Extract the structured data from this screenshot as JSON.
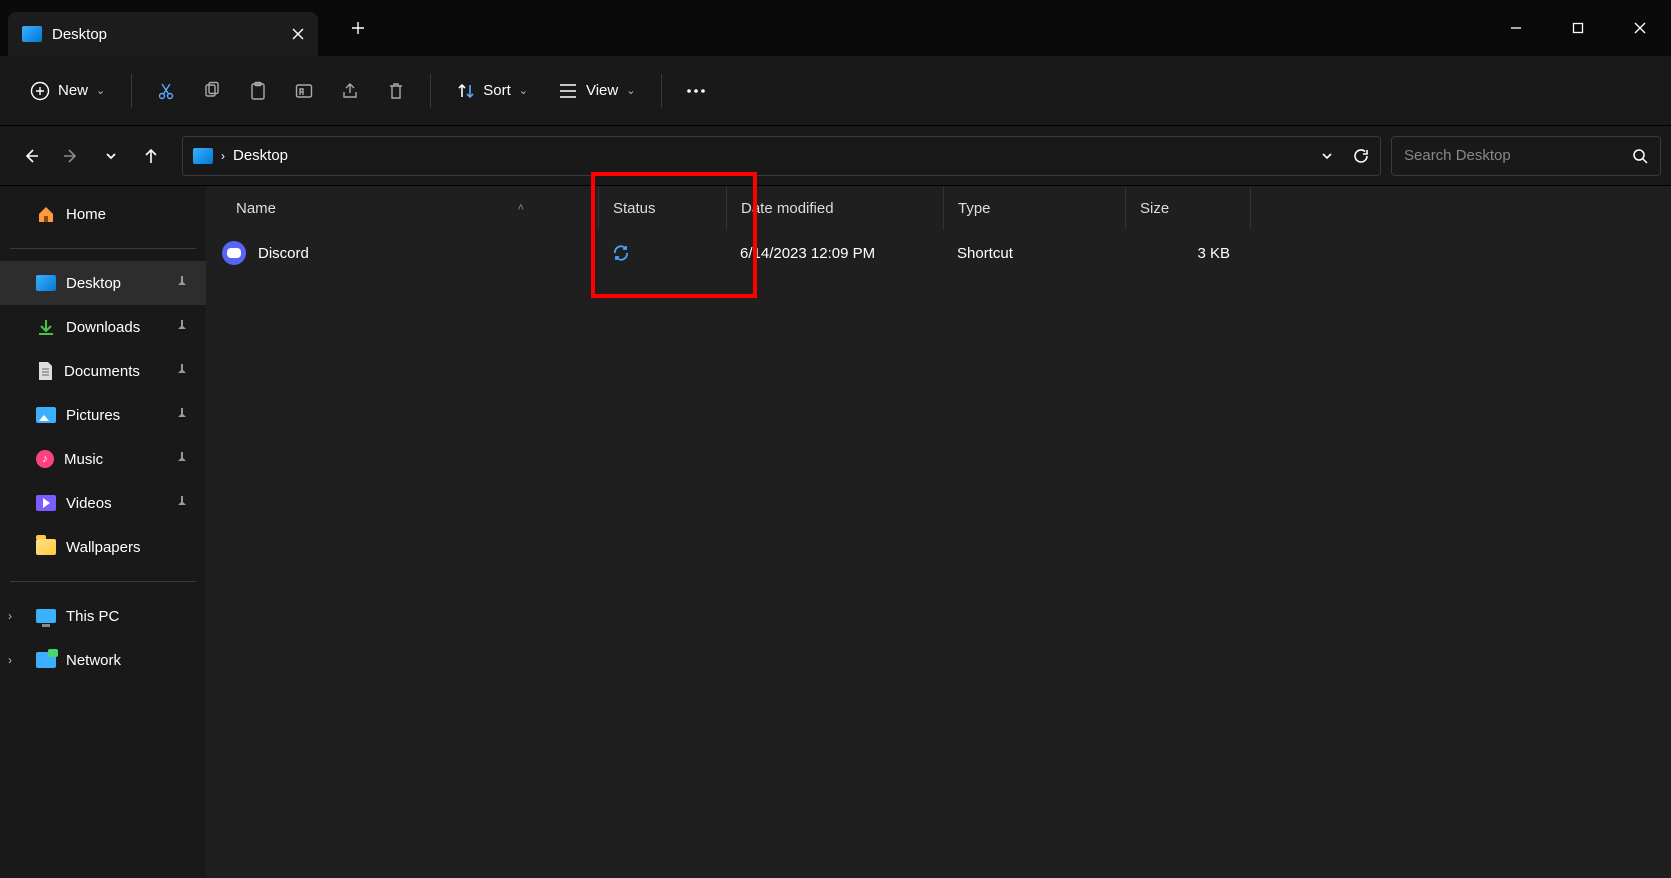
{
  "window": {
    "title": "Desktop"
  },
  "toolbar": {
    "new_label": "New",
    "sort_label": "Sort",
    "view_label": "View"
  },
  "breadcrumb": {
    "location": "Desktop"
  },
  "search": {
    "placeholder": "Search Desktop"
  },
  "sidebar": {
    "home": "Home",
    "desktop": "Desktop",
    "downloads": "Downloads",
    "documents": "Documents",
    "pictures": "Pictures",
    "music": "Music",
    "videos": "Videos",
    "wallpapers": "Wallpapers",
    "this_pc": "This PC",
    "network": "Network"
  },
  "columns": {
    "name": "Name",
    "status": "Status",
    "date_modified": "Date modified",
    "type": "Type",
    "size": "Size"
  },
  "files": [
    {
      "name": "Discord",
      "date_modified": "6/14/2023 12:09 PM",
      "type": "Shortcut",
      "size": "3 KB"
    }
  ]
}
